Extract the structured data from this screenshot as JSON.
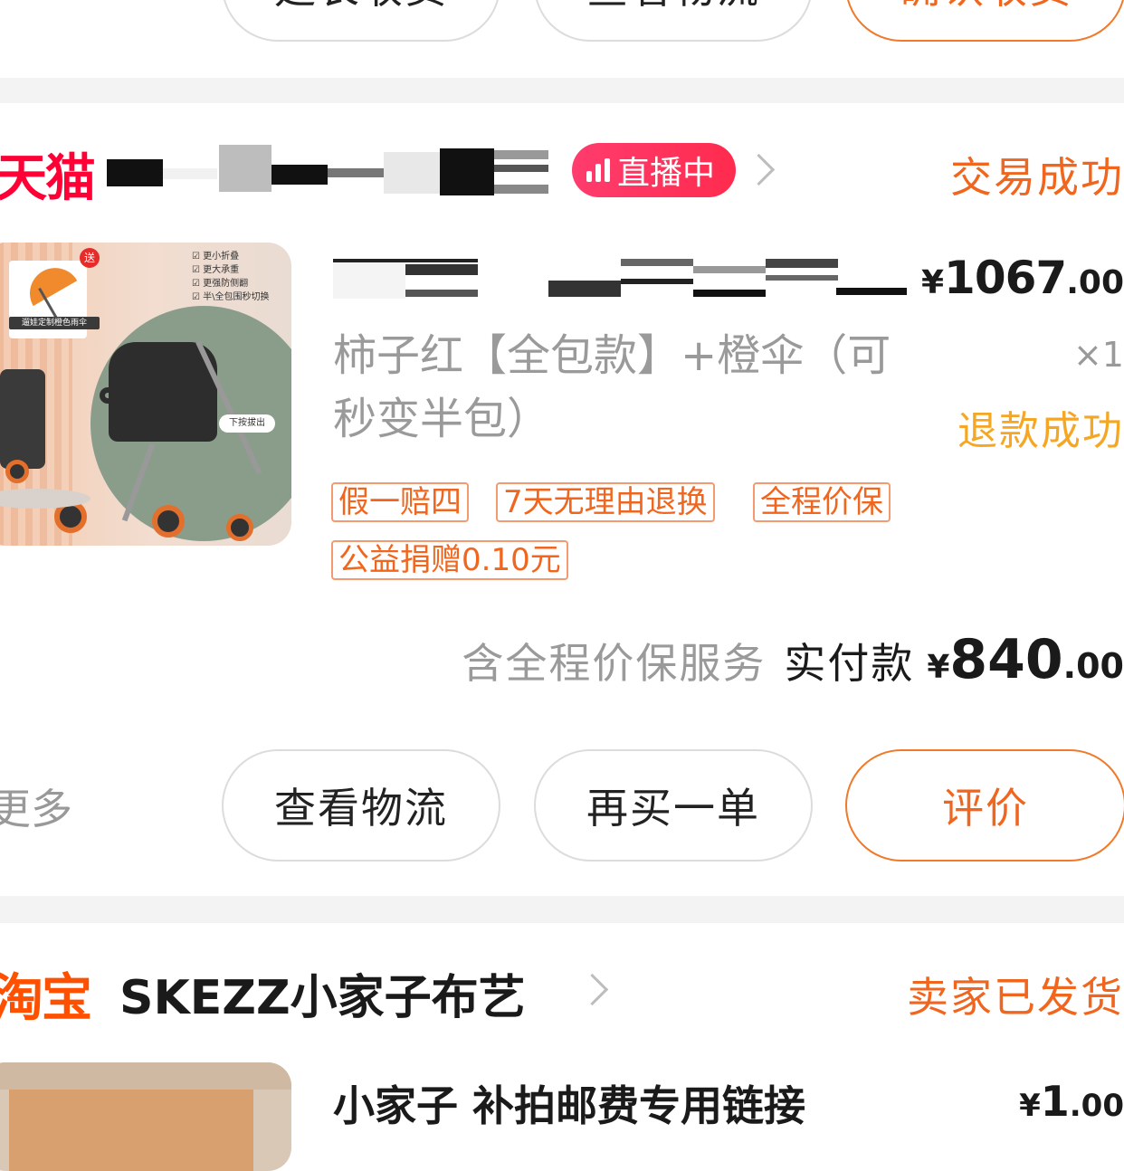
{
  "top_order": {
    "buttons": [
      "延长收货",
      "查看物流",
      "确认收货"
    ]
  },
  "order1": {
    "platform": "天猫",
    "live_badge": "直播中",
    "status": "交易成功",
    "product": {
      "spec": "柿子红【全包款】+橙伞（可秒变半包）",
      "price_symbol": "¥",
      "price_int": "1067",
      "price_dec": ".00",
      "quantity": "×1",
      "refund_status": "退款成功",
      "tags": [
        "假一赔四",
        "7天无理由退换",
        "全程价保"
      ],
      "donation": "公益捐赠0.10元",
      "image_texts": {
        "gift": "送",
        "umbrella_caption": "遛娃定制橙色雨伞",
        "features": [
          "更小折叠",
          "更大承重",
          "更强防侧翻",
          "半\\全包围秒切换"
        ],
        "press_hint": "下按拔出"
      }
    },
    "summary": {
      "note": "含全程价保服务",
      "paid_label": "实付款",
      "symbol": "¥",
      "int": "840",
      "dec": ".00"
    },
    "more_label": "更多",
    "buttons": {
      "logistics": "查看物流",
      "rebuy": "再买一单",
      "review": "评价"
    }
  },
  "order2": {
    "platform": "淘宝",
    "shop_name": "SKEZZ小家子布艺",
    "status": "卖家已发货",
    "product": {
      "title": "小家子 补拍邮费专用链接",
      "price_symbol": "¥",
      "price_int": "1",
      "price_dec": ".00"
    }
  },
  "colors": {
    "accent_orange": "#f0661e",
    "tmall_red": "#ff0036",
    "taobao_orange": "#ff5000",
    "live_pink": "#ff2b4e",
    "refund_yellow": "#f5a623",
    "divider_gray": "#f3f3f3"
  }
}
